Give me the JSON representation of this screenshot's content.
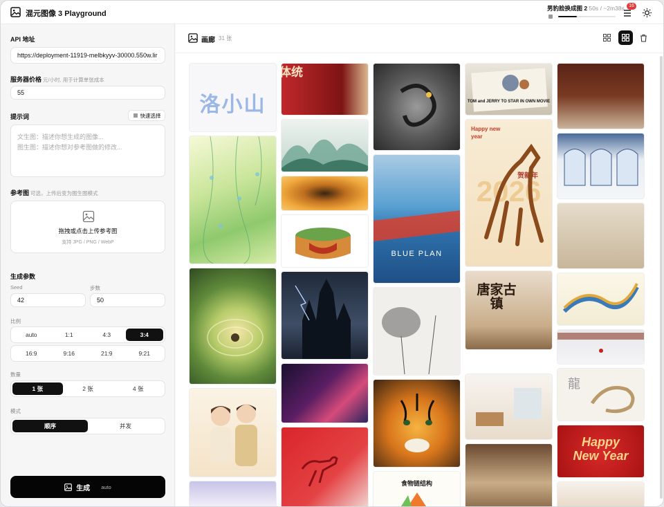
{
  "app": {
    "title": "混元图像 3 Playground",
    "logo_icon": "image-icon"
  },
  "task": {
    "name": "男豹脸换成图 2",
    "elapsed": "50s",
    "eta": "/ ~2m38s",
    "progress": 0.32
  },
  "topbar": {
    "badge_count": "16",
    "list_icon": "list-icon",
    "theme_icon": "sun-icon"
  },
  "sidebar": {
    "api": {
      "label": "API 地址",
      "value": "https://deployment-11919-melbkyyv-30000.550w.lir"
    },
    "price": {
      "label": "服务器价格",
      "hint": "元/小时, 用于计算单张成本",
      "value": "55"
    },
    "prompt": {
      "label": "提示词",
      "quick_select": "快速选择",
      "placeholder_line1": "文生图：描述你想生成的图像...",
      "placeholder_line2": "图生图：描述你想对参考图做的修改..."
    },
    "reference": {
      "label": "参考图",
      "hint": "可选，上传后变为图生图模式",
      "upload_text": "拖拽或点击上传参考图",
      "upload_sub": "支持 JPG / PNG / WebP"
    },
    "params": {
      "label": "生成参数",
      "seed_label": "Seed",
      "seed_value": "42",
      "steps_label": "步数",
      "steps_value": "50",
      "ratio_label": "比例",
      "ratios_row1": [
        "auto",
        "1:1",
        "4:3",
        "3:4"
      ],
      "ratios_row2": [
        "16:9",
        "9:16",
        "21:9",
        "9:21"
      ],
      "ratio_selected": "3:4",
      "count_label": "数量",
      "counts": [
        "1 张",
        "2 张",
        "4 张"
      ],
      "count_selected": "1 张",
      "mode_label": "模式",
      "modes": [
        "顺序",
        "并发"
      ],
      "mode_selected": "顺序"
    },
    "generate": {
      "label": "生成",
      "mode": "auto"
    }
  },
  "gallery": {
    "title": "画廊",
    "count": "31 张",
    "tile_text": {
      "xiaoshan": "洛小山",
      "wedding": "成何体统",
      "tomjerry": "TOM and JERRY TO STAR IN OWN MOVIE",
      "happy": "Happy new year",
      "year": "2026",
      "greeting": "贺新年",
      "blueplan": "BLUE PLAN",
      "tang": "唐家古镇",
      "foodchain": "食物链结构",
      "dragon_char": "龍",
      "happynewyear": "Happy New Year"
    }
  },
  "colors": {
    "accent": "#111111",
    "badge": "#e03b3b",
    "bg": "#fafafa"
  }
}
